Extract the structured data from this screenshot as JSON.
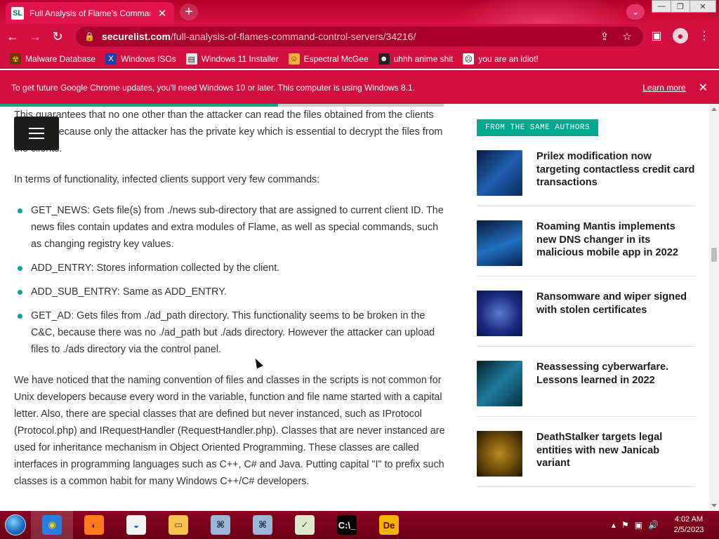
{
  "browser": {
    "tab": {
      "favicon_text": "SL",
      "title": "Full Analysis of Flame's Command",
      "close_glyph": "✕"
    },
    "new_tab_glyph": "+",
    "tab_search_glyph": "⌄",
    "window_controls": {
      "minimize": "—",
      "maximize": "❐",
      "close": "✕"
    },
    "nav": {
      "back": "←",
      "forward": "→",
      "reload": "↻"
    },
    "address": {
      "host": "securelist.com",
      "path": "/full-analysis-of-flames-command-control-servers/34216/",
      "lock_glyph": "🔒",
      "share_glyph": "⇪",
      "star_glyph": "☆"
    },
    "toolbar_right": {
      "sidepanel_glyph": "▣",
      "profile_glyph": "●",
      "menu_glyph": "⋮"
    },
    "bookmarks": [
      {
        "label": "Malware Database",
        "icon": "hazard-icon",
        "glyph": "☢",
        "bg": "#6b3a00",
        "fg": "#f5c400"
      },
      {
        "label": "Windows ISOs",
        "icon": "x-icon",
        "glyph": "X",
        "bg": "#1f3fa8",
        "fg": "#ffffff"
      },
      {
        "label": "Windows 11 Installer",
        "icon": "installer-icon",
        "glyph": "▤",
        "bg": "#e8e8e8",
        "fg": "#333333"
      },
      {
        "label": "Espectral McGee",
        "icon": "face-icon",
        "glyph": "☺",
        "bg": "#f0b040",
        "fg": "#5a2a00"
      },
      {
        "label": "uhhh anime shit",
        "icon": "anime-icon",
        "glyph": "☻",
        "bg": "#222222",
        "fg": "#ffffff"
      },
      {
        "label": "you are an idiot!",
        "icon": "idiot-icon",
        "glyph": "☹",
        "bg": "#ffffff",
        "fg": "#000000"
      }
    ],
    "infobar": {
      "message": "To get future Google Chrome updates, you'll need Windows 10 or later. This computer is using Windows 8.1.",
      "link": "Learn more",
      "close_glyph": "✕"
    }
  },
  "article": {
    "p1": "This guarantees that no one other than the attacker can read the files obtained from the clients storage, because only the attacker has the private key which is essential to decrypt the files from the clients.",
    "p2": "In terms of functionality, infected clients support very few commands:",
    "commands": [
      "GET_NEWS: Gets file(s) from ./news sub-directory that are assigned to current client ID. The news files contain updates and extra modules of Flame, as well as special commands, such as changing registry key values.",
      "ADD_ENTRY: Stores information collected by the client.",
      "ADD_SUB_ENTRY: Same as ADD_ENTRY.",
      "GET_AD: Gets files from ./ad_path directory. This functionality seems to be broken in the C&C, because there was no ./ad_path but ./ads directory. However the attacker can upload files to ./ads directory via the control panel."
    ],
    "p3": "We have noticed that the naming convention of files and classes in the scripts is not common for Unix developers because every word in the variable, function and file name started with a capital letter. Also, there are special classes that are defined but never instanced, such as IProtocol (Protocol.php) and IRequestHandler (RequestHandler.php). Classes that are never instanced are used for inheritance mechanism in Object Oriented Programming. These classes are called interfaces in programming languages such as C++, C# and Java. Putting capital \"I\" to prefix such classes is a common habit for many Windows C++/C# developers."
  },
  "sidebar": {
    "heading": "FROM THE SAME AUTHORS",
    "items": [
      {
        "title": "Prilex modification now targeting contactless credit card transactions",
        "thumb": "linear-gradient(135deg,#0a1a40 0%,#1f5fb0 50%,#0b2a60 100%)"
      },
      {
        "title": "Roaming Mantis implements new DNS changer in its malicious mobile app in 2022",
        "thumb": "linear-gradient(160deg,#0a1a3a 0%,#2070c0 55%,#0a2050 100%)"
      },
      {
        "title": "Ransomware and wiper signed with stolen certificates",
        "thumb": "radial-gradient(circle at 50% 50%,#5a7ad0 0%,#1a2a80 60%,#0a1550 100%)"
      },
      {
        "title": "Reassessing cyberwarfare. Lessons learned in 2022",
        "thumb": "linear-gradient(135deg,#06202a 0%,#1a7a9a 50%,#083040 100%)"
      },
      {
        "title": "DeathStalker targets legal entities with new Janicab variant",
        "thumb": "radial-gradient(circle at 50% 50%,#b88a20 0%,#6a4a08 55%,#201404 100%)"
      }
    ]
  },
  "taskbar": {
    "apps": [
      {
        "name": "chrome",
        "glyph": "◉",
        "bg": "#2a7de1",
        "fg": "#fbd000",
        "active": true
      },
      {
        "name": "firefox",
        "glyph": "◐",
        "bg": "#ff7a1a",
        "fg": "#5a1ab0",
        "active": false
      },
      {
        "name": "obama",
        "glyph": "◒",
        "bg": "#f0f0f0",
        "fg": "#1c58b0",
        "active": false
      },
      {
        "name": "file-explorer",
        "glyph": "▭",
        "bg": "#f2c24a",
        "fg": "#6a4a00",
        "active": false
      },
      {
        "name": "network-app-1",
        "glyph": "⌘",
        "bg": "#9ab7d8",
        "fg": "#203040",
        "active": false
      },
      {
        "name": "network-app-2",
        "glyph": "⌘",
        "bg": "#9ab7d8",
        "fg": "#203040",
        "active": false
      },
      {
        "name": "task-app",
        "glyph": "✓",
        "bg": "#dfe8cf",
        "fg": "#2a6a2a",
        "active": false
      },
      {
        "name": "command-prompt",
        "glyph": "C:\\_",
        "bg": "#000000",
        "fg": "#ffffff",
        "active": false
      },
      {
        "name": "de-app",
        "glyph": "De",
        "bg": "#f2b400",
        "fg": "#6a0000",
        "active": false
      }
    ],
    "tray": {
      "chevron": "▴",
      "flag": "⚑",
      "network": "▣",
      "volume": "🔊"
    },
    "clock": {
      "time": "4:02 AM",
      "date": "2/5/2023"
    }
  },
  "colors": {
    "theme_red": "#d11040",
    "accent_teal": "#00a88e"
  }
}
